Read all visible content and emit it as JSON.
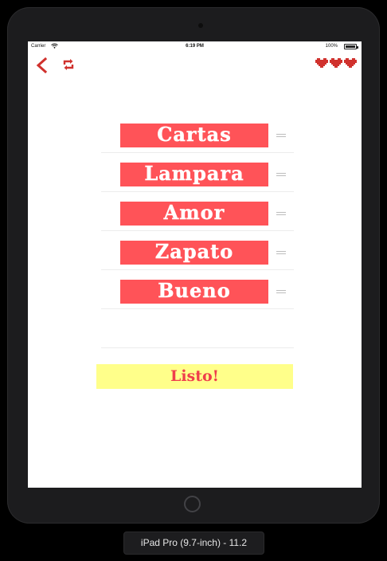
{
  "status_bar": {
    "carrier": "Carrier",
    "time": "6:19 PM",
    "battery": "100%"
  },
  "nav": {
    "back_icon": "chevron-left-icon",
    "repeat_icon": "repeat-icon",
    "lives": 3,
    "heart_icon": "pixel-heart-icon"
  },
  "words": [
    {
      "label": "Cartas"
    },
    {
      "label": "Lampara"
    },
    {
      "label": "Amor"
    },
    {
      "label": "Zapato"
    },
    {
      "label": "Bueno"
    }
  ],
  "done_button": {
    "label": "Listo!"
  },
  "device_label": "iPad Pro (9.7-inch) - 11.2",
  "colors": {
    "accent_red": "#ff5358",
    "icon_red": "#d0312d",
    "button_yellow": "#ffff8a",
    "button_text": "#ef3d4c"
  }
}
